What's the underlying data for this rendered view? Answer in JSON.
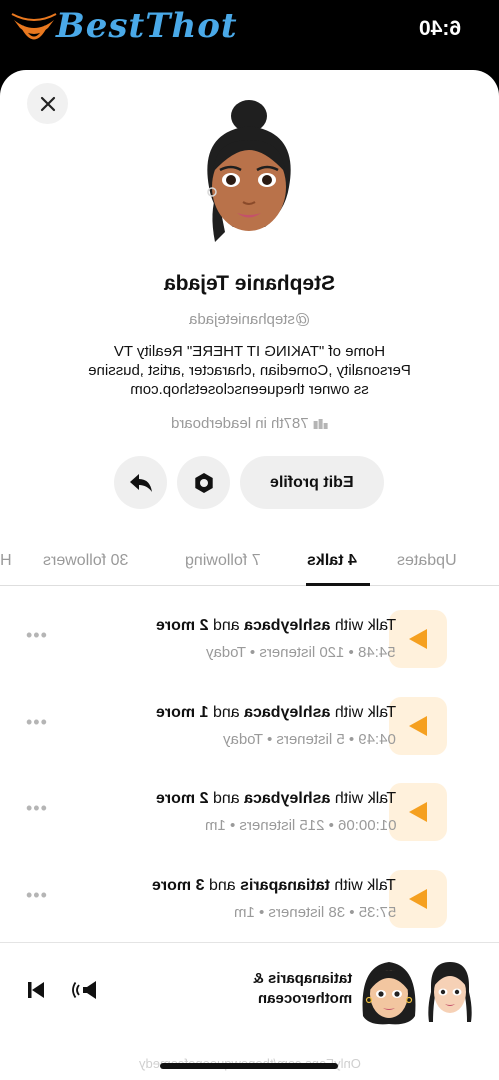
{
  "status": {
    "time": "6:40"
  },
  "watermark": {
    "brand": "BestThot",
    "footer": "OnlyFans.com/thenewqueenofcomedy"
  },
  "profile": {
    "name": "Stephanie Tejada",
    "handle": "@stephanietejada",
    "bio_lines": [
      "Home of  \"TAKING IT THERE\"  Reality TV",
      "Personality ,Comedian ,character ,artist ,bussine",
      "ss owner thequeensclosetshop.com"
    ],
    "rank": "787th in leaderboard",
    "edit_label": "Edit profile"
  },
  "tabs": [
    "Updates",
    "4 talks",
    "7 following",
    "30 followers",
    "H"
  ],
  "active_tab": "4 talks",
  "talks": [
    {
      "prefix": "Talk with",
      "user": "ashleybaca",
      "joiner": "and",
      "more": "2 more",
      "meta": "54:48 • 120 listeners • Today"
    },
    {
      "prefix": "Talk with",
      "user": "ashleybaca",
      "joiner": "and",
      "more": "1 more",
      "meta": "04:49 • 5 listeners • Today"
    },
    {
      "prefix": "Talk with",
      "user": "ashleybaca",
      "joiner": "and",
      "more": "2 more",
      "meta": "01:00:06 • 215 listeners • 1m"
    },
    {
      "prefix": "Talk with",
      "user": "tatianaparis",
      "joiner": "and",
      "more": "3 more",
      "meta": "57:35 • 38 listeners • 1m"
    }
  ],
  "more_label": "•••",
  "player": {
    "line1": "tatianaparis &",
    "line2": "motherocean"
  },
  "colors": {
    "accent": "#f5a020",
    "play_bg": "#fff1dc",
    "watermark_blue": "#4aa9e8"
  }
}
